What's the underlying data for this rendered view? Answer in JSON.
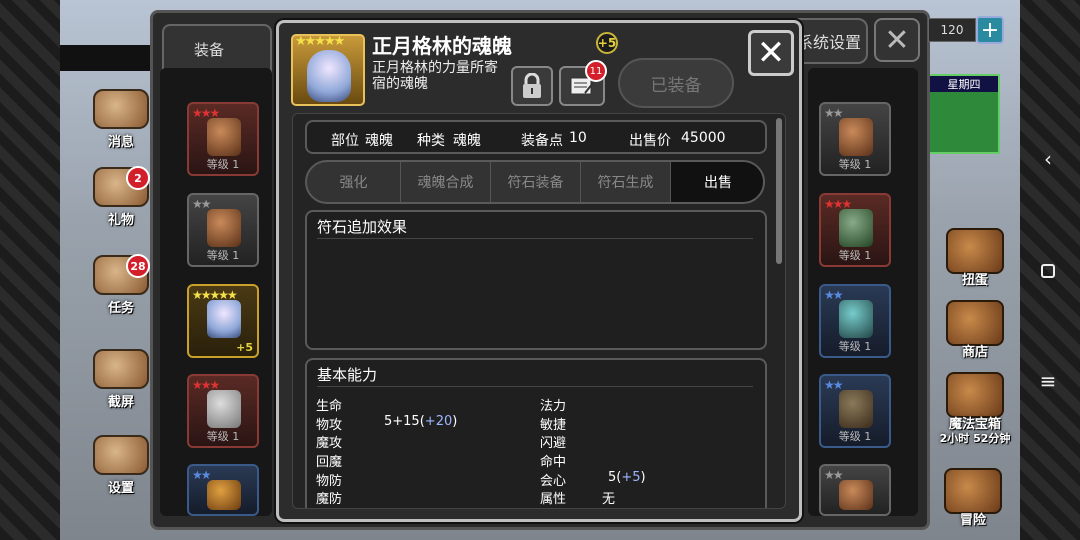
{
  "hud": {
    "coins": "120",
    "weekday": "星期四"
  },
  "left_menu": [
    {
      "label": "消息",
      "badge": ""
    },
    {
      "label": "礼物",
      "badge": "2"
    },
    {
      "label": "任务",
      "badge": "28"
    },
    {
      "label": "截屏",
      "badge": ""
    },
    {
      "label": "设置",
      "badge": ""
    }
  ],
  "right_menu": [
    {
      "label": "扭蛋"
    },
    {
      "label": "商店"
    },
    {
      "label": "魔法宝箱",
      "sub": "2小时 52分钟"
    },
    {
      "label": "冒险"
    }
  ],
  "outer_tabs": {
    "equip": "装备",
    "settings": "系统设置"
  },
  "inventory_left": [
    {
      "stars": "★★★",
      "level": "等级 1",
      "color": "red"
    },
    {
      "stars": "★★",
      "level": "等级 1",
      "color": "gray"
    },
    {
      "stars": "★★★★★",
      "level": "",
      "plus": "+5",
      "color": "gold"
    },
    {
      "stars": "★★★",
      "level": "等级 1",
      "color": "red"
    },
    {
      "stars": "★★",
      "level": "",
      "color": "blue"
    }
  ],
  "inventory_right": [
    {
      "stars": "★★",
      "level": "等级 1",
      "color": "red"
    },
    {
      "stars": "★★★",
      "level": "等级 1",
      "color": "red"
    },
    {
      "stars": "★★",
      "level": "等级 1",
      "color": "blue"
    },
    {
      "stars": "★★",
      "level": "等级 1",
      "color": "blue"
    },
    {
      "stars": "★★",
      "level": "",
      "color": "red"
    }
  ],
  "dialog": {
    "title": "正月格林的魂魄",
    "enhance": "+5",
    "description": "正月格林的力量所寄宿的魂魄",
    "note_badge": "11",
    "equipped_label": "已装备",
    "info": {
      "slot_label": "部位",
      "slot_value": "魂魄",
      "type_label": "种类",
      "type_value": "魂魄",
      "points_label": "装备点",
      "points_value": "10",
      "price_label": "出售价",
      "price_value": "45000"
    },
    "actions": [
      "强化",
      "魂魄合成",
      "符石装备",
      "符石生成",
      "出售"
    ],
    "rune_section": {
      "title": "符石追加效果"
    },
    "basic_section": {
      "title": "基本能力",
      "left": [
        {
          "label": "生命",
          "base": "",
          "bonus": ""
        },
        {
          "label": "物攻",
          "base": "5+15",
          "bonus": "+20"
        },
        {
          "label": "魔攻",
          "base": "",
          "bonus": ""
        },
        {
          "label": "回魔",
          "base": "",
          "bonus": ""
        },
        {
          "label": "物防",
          "base": "",
          "bonus": ""
        },
        {
          "label": "魔防",
          "base": "",
          "bonus": ""
        }
      ],
      "right": [
        {
          "label": "法力",
          "base": "",
          "bonus": ""
        },
        {
          "label": "敏捷",
          "base": "",
          "bonus": ""
        },
        {
          "label": "闪避",
          "base": "",
          "bonus": ""
        },
        {
          "label": "命中",
          "base": "",
          "bonus": ""
        },
        {
          "label": "会心",
          "base": "5",
          "bonus": "+5"
        },
        {
          "label": "属性",
          "base": "无",
          "bonus": ""
        }
      ]
    }
  },
  "colors": {
    "accent_gold": "#e6d23a",
    "bonus_blue": "#9bb8ff",
    "badge_red": "#d21f2a"
  }
}
